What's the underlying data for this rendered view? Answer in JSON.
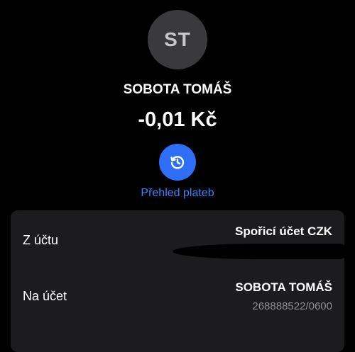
{
  "contact": {
    "initials": "ST",
    "name": "SOBOTA TOMÁŠ"
  },
  "transaction": {
    "amount": "-0,01 Kč"
  },
  "history": {
    "icon": "history-icon",
    "label": "Přehled plateb"
  },
  "details": {
    "from": {
      "label": "Z účtu",
      "value": "Spořicí účet CZK"
    },
    "to": {
      "label": "Na účet",
      "value": "SOBOTA TOMÁŠ",
      "account_number": "268888522/0600"
    }
  },
  "colors": {
    "background": "#000000",
    "card": "#1c1c1e",
    "accent": "#2f6ef7",
    "link": "#3b82ff",
    "secondary_text": "#8e8e93"
  }
}
